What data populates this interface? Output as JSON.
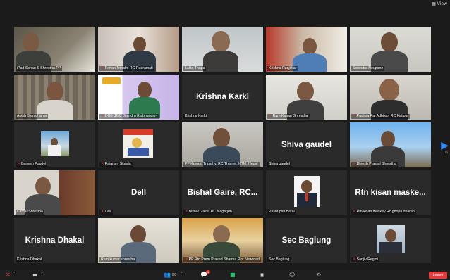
{
  "top": {
    "view_label": "View"
  },
  "tiles": [
    {
      "name": "iPad Sohan S Shrestha PP",
      "muted": false,
      "center": ""
    },
    {
      "name": "Rohan Tripathi RC Rudramati",
      "muted": true,
      "center": ""
    },
    {
      "name": "Lalita Thapa",
      "muted": false,
      "center": ""
    },
    {
      "name": "Krishna Ranjitkar",
      "muted": false,
      "center": ""
    },
    {
      "name": "Sobindra Neupane",
      "muted": false,
      "center": ""
    },
    {
      "name": "Anish Bajracharya",
      "muted": false,
      "center": ""
    },
    {
      "name": "DGE 3292 Jitendra Rajbhandary",
      "muted": true,
      "center": ""
    },
    {
      "name": "Krishna Karki",
      "muted": false,
      "center": "Krishna Karki"
    },
    {
      "name": "Ram Kumar Shrestha",
      "muted": true,
      "center": ""
    },
    {
      "name": "Pushpa Raj Adhikari RC Kirtipur",
      "muted": true,
      "center": ""
    },
    {
      "name": "Ganesh Poudel",
      "muted": true,
      "center": ""
    },
    {
      "name": "Rajaram Sitaula",
      "muted": true,
      "center": ""
    },
    {
      "name": "PP Kumud Tripathy, RC Thamel, KTM, Nepal",
      "muted": false,
      "center": ""
    },
    {
      "name": "Shiva gaudel",
      "muted": false,
      "center": "Shiva gaudel"
    },
    {
      "name": "Dinesh Prasad Shrestha",
      "muted": true,
      "center": ""
    },
    {
      "name": "Kamal Shrestha",
      "muted": false,
      "center": ""
    },
    {
      "name": "Dell",
      "muted": true,
      "center": "Dell"
    },
    {
      "name": "Bishal Gaire, RC Nagarjun",
      "muted": true,
      "center": "Bishal Gaire, RC..."
    },
    {
      "name": "Pashupati Baral",
      "muted": false,
      "center": ""
    },
    {
      "name": "Rtn kisan maskey Rc ghopa dharan",
      "muted": true,
      "center": "Rtn kisan maske..."
    },
    {
      "name": "Krishna Dhakal",
      "muted": false,
      "center": "Krishna Dhakal"
    },
    {
      "name": "Ram kumar shrestha",
      "muted": false,
      "center": ""
    },
    {
      "name": "PP Rtn Prem Prasad Sharma Rcc Newroad",
      "muted": true,
      "center": ""
    },
    {
      "name": "Sec Baglung",
      "muted": false,
      "center": "Sec Baglung"
    },
    {
      "name": "Sanjiv Regmi",
      "muted": true,
      "center": ""
    }
  ],
  "pager": {
    "indicator": "1/6"
  },
  "toolbar": {
    "participants_count": "80",
    "chat_badge": "1",
    "leave_label": "Leave"
  },
  "colors": {
    "accent": "#2d8cff",
    "mute": "#e23b3b",
    "speaker": "#c8d35a"
  }
}
